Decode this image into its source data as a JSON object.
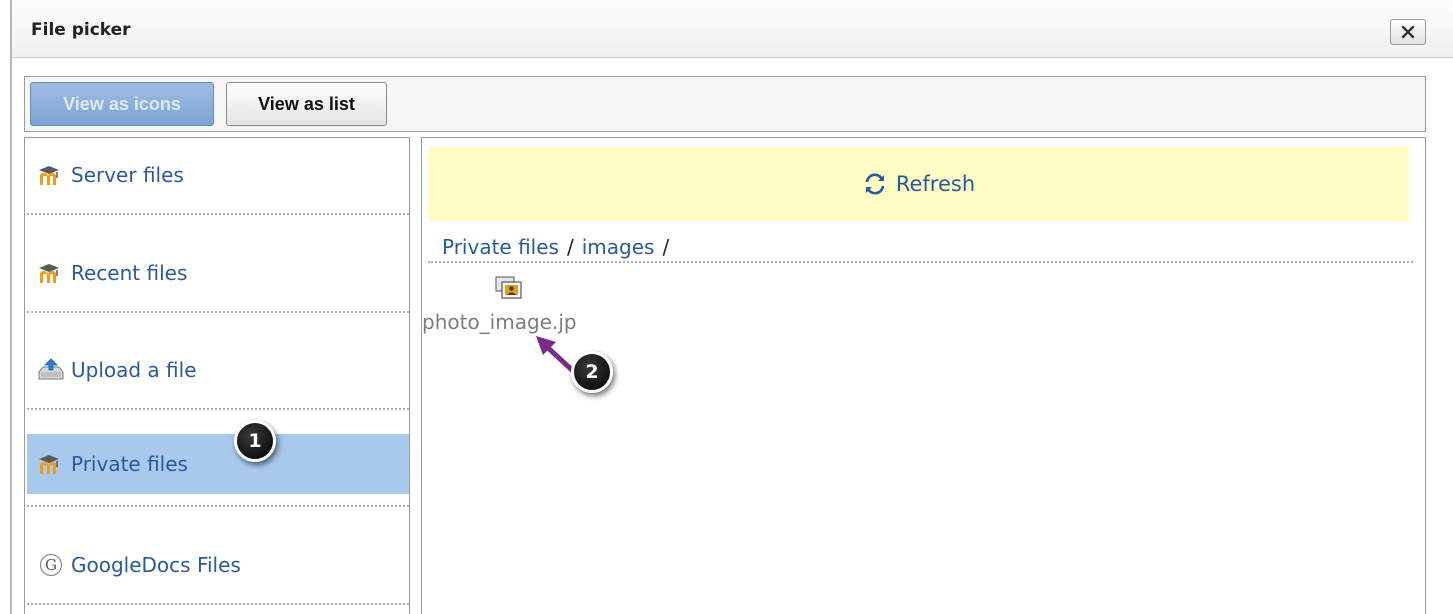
{
  "dialog": {
    "title": "File picker",
    "close_icon": "close-icon"
  },
  "toolbar": {
    "view_icons_label": "View as icons",
    "view_list_label": "View as list"
  },
  "sidebar": {
    "items": [
      {
        "label": "Server files",
        "icon": "moodle-icon",
        "selected": false
      },
      {
        "label": "Recent files",
        "icon": "moodle-icon",
        "selected": false
      },
      {
        "label": "Upload a file",
        "icon": "upload-icon",
        "selected": false
      },
      {
        "label": "Private files",
        "icon": "moodle-icon",
        "selected": true
      },
      {
        "label": "GoogleDocs Files",
        "icon": "google-icon",
        "selected": false
      }
    ]
  },
  "main": {
    "refresh_label": "Refresh",
    "breadcrumb": [
      "Private files",
      "images"
    ],
    "breadcrumb_separator": "/",
    "files": [
      {
        "name": "photo_image.jp",
        "icon": "image-file-icon"
      }
    ]
  },
  "callouts": [
    "1",
    "2"
  ],
  "colors": {
    "link": "#2a5a9e",
    "selected_bg": "#a8c8ec",
    "refresh_bg": "#fdfdc4",
    "arrow": "#7b2a8c"
  }
}
